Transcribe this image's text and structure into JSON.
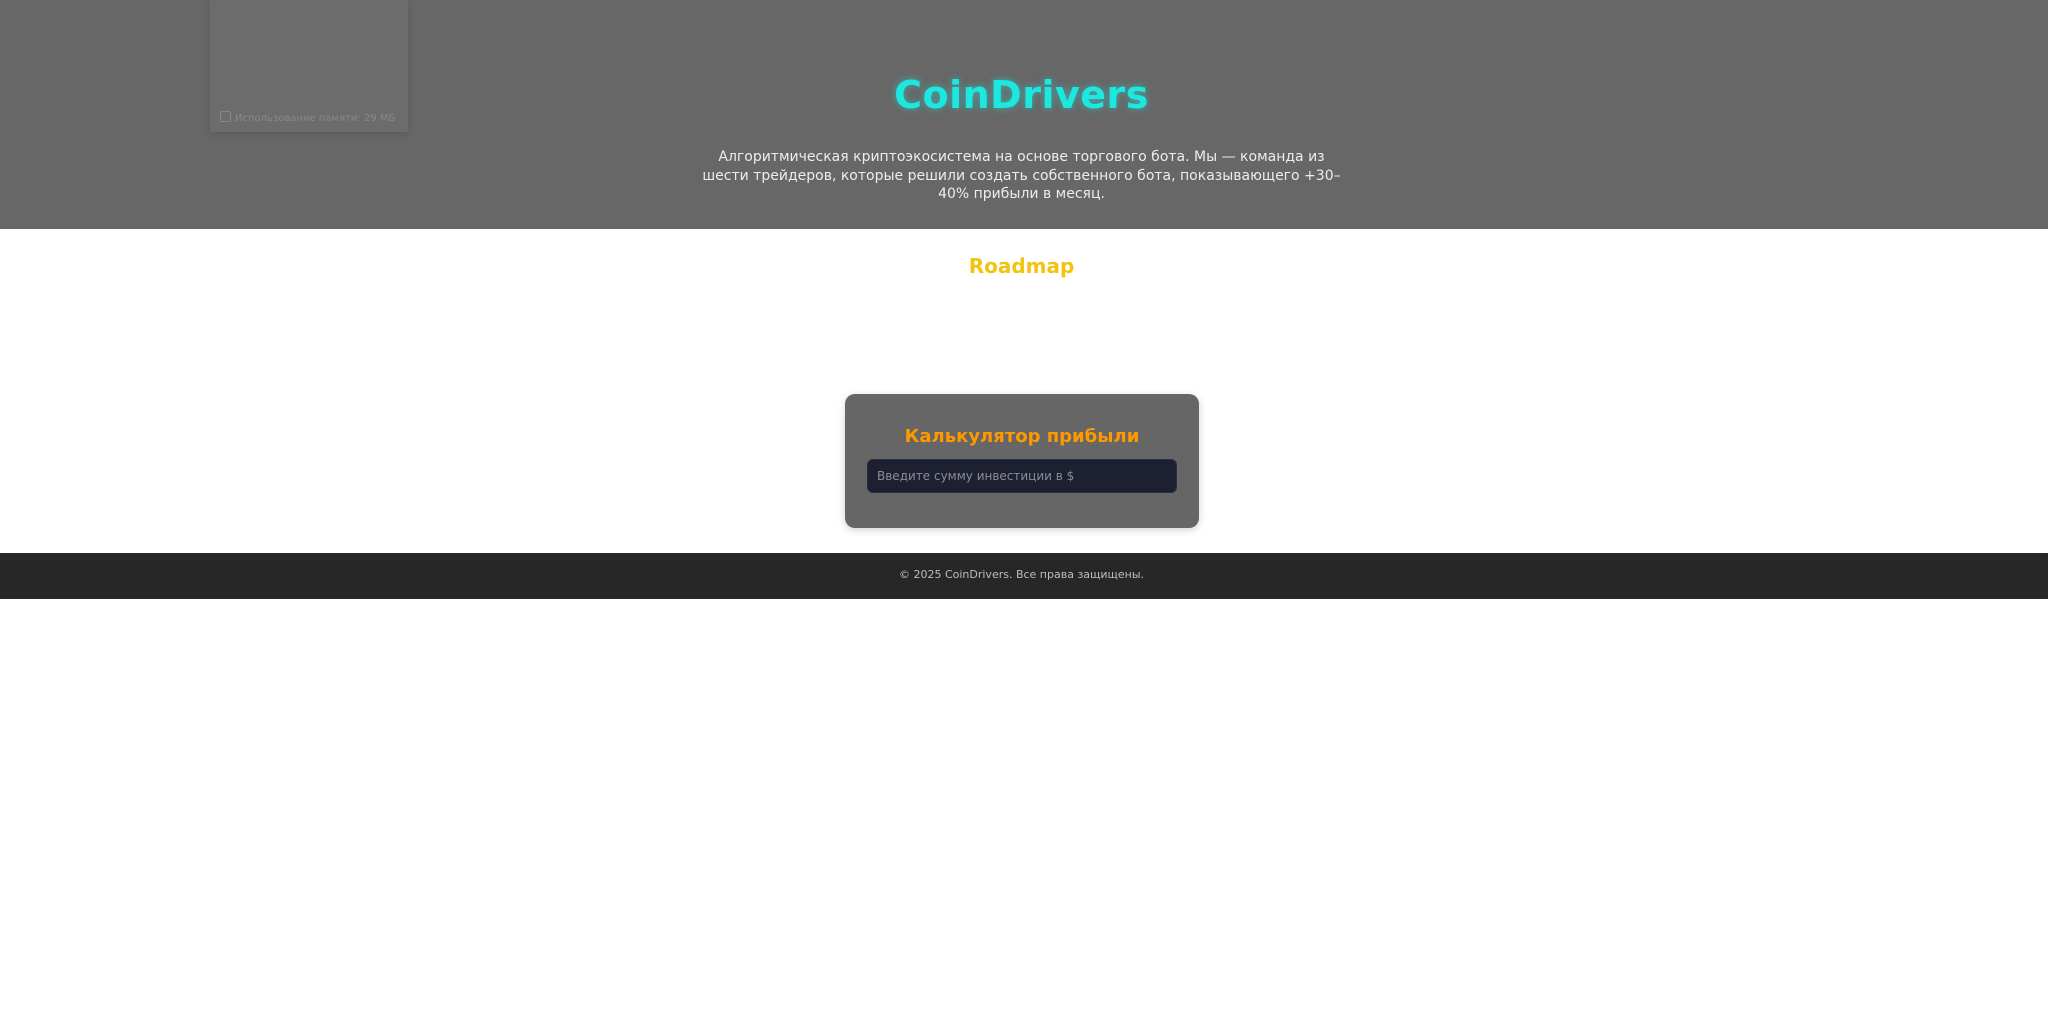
{
  "header": {
    "title": "CoinDrivers",
    "description": "Алгоритмическая криптоэкосистема на основе торгового бота. Мы — команда из шести трейдеров, которые решили создать собственного бота, показывающего +30–40% прибыли в месяц.",
    "background": "#676767",
    "title_color": "#1ce8e0"
  },
  "memory_overlay": {
    "label": "Использование памяти: 29 МБ",
    "icon": "memory-chip-icon"
  },
  "roadmap": {
    "heading": "Roadmap",
    "heading_color": "#f2c40f"
  },
  "calculator": {
    "title": "Калькулятор прибыли",
    "title_color": "#ff9900",
    "input_value": "",
    "input_placeholder": "Введите сумму инвестиции в $"
  },
  "footer": {
    "text": "© 2025 CoinDrivers. Все права защищены.",
    "background": "#272727"
  }
}
